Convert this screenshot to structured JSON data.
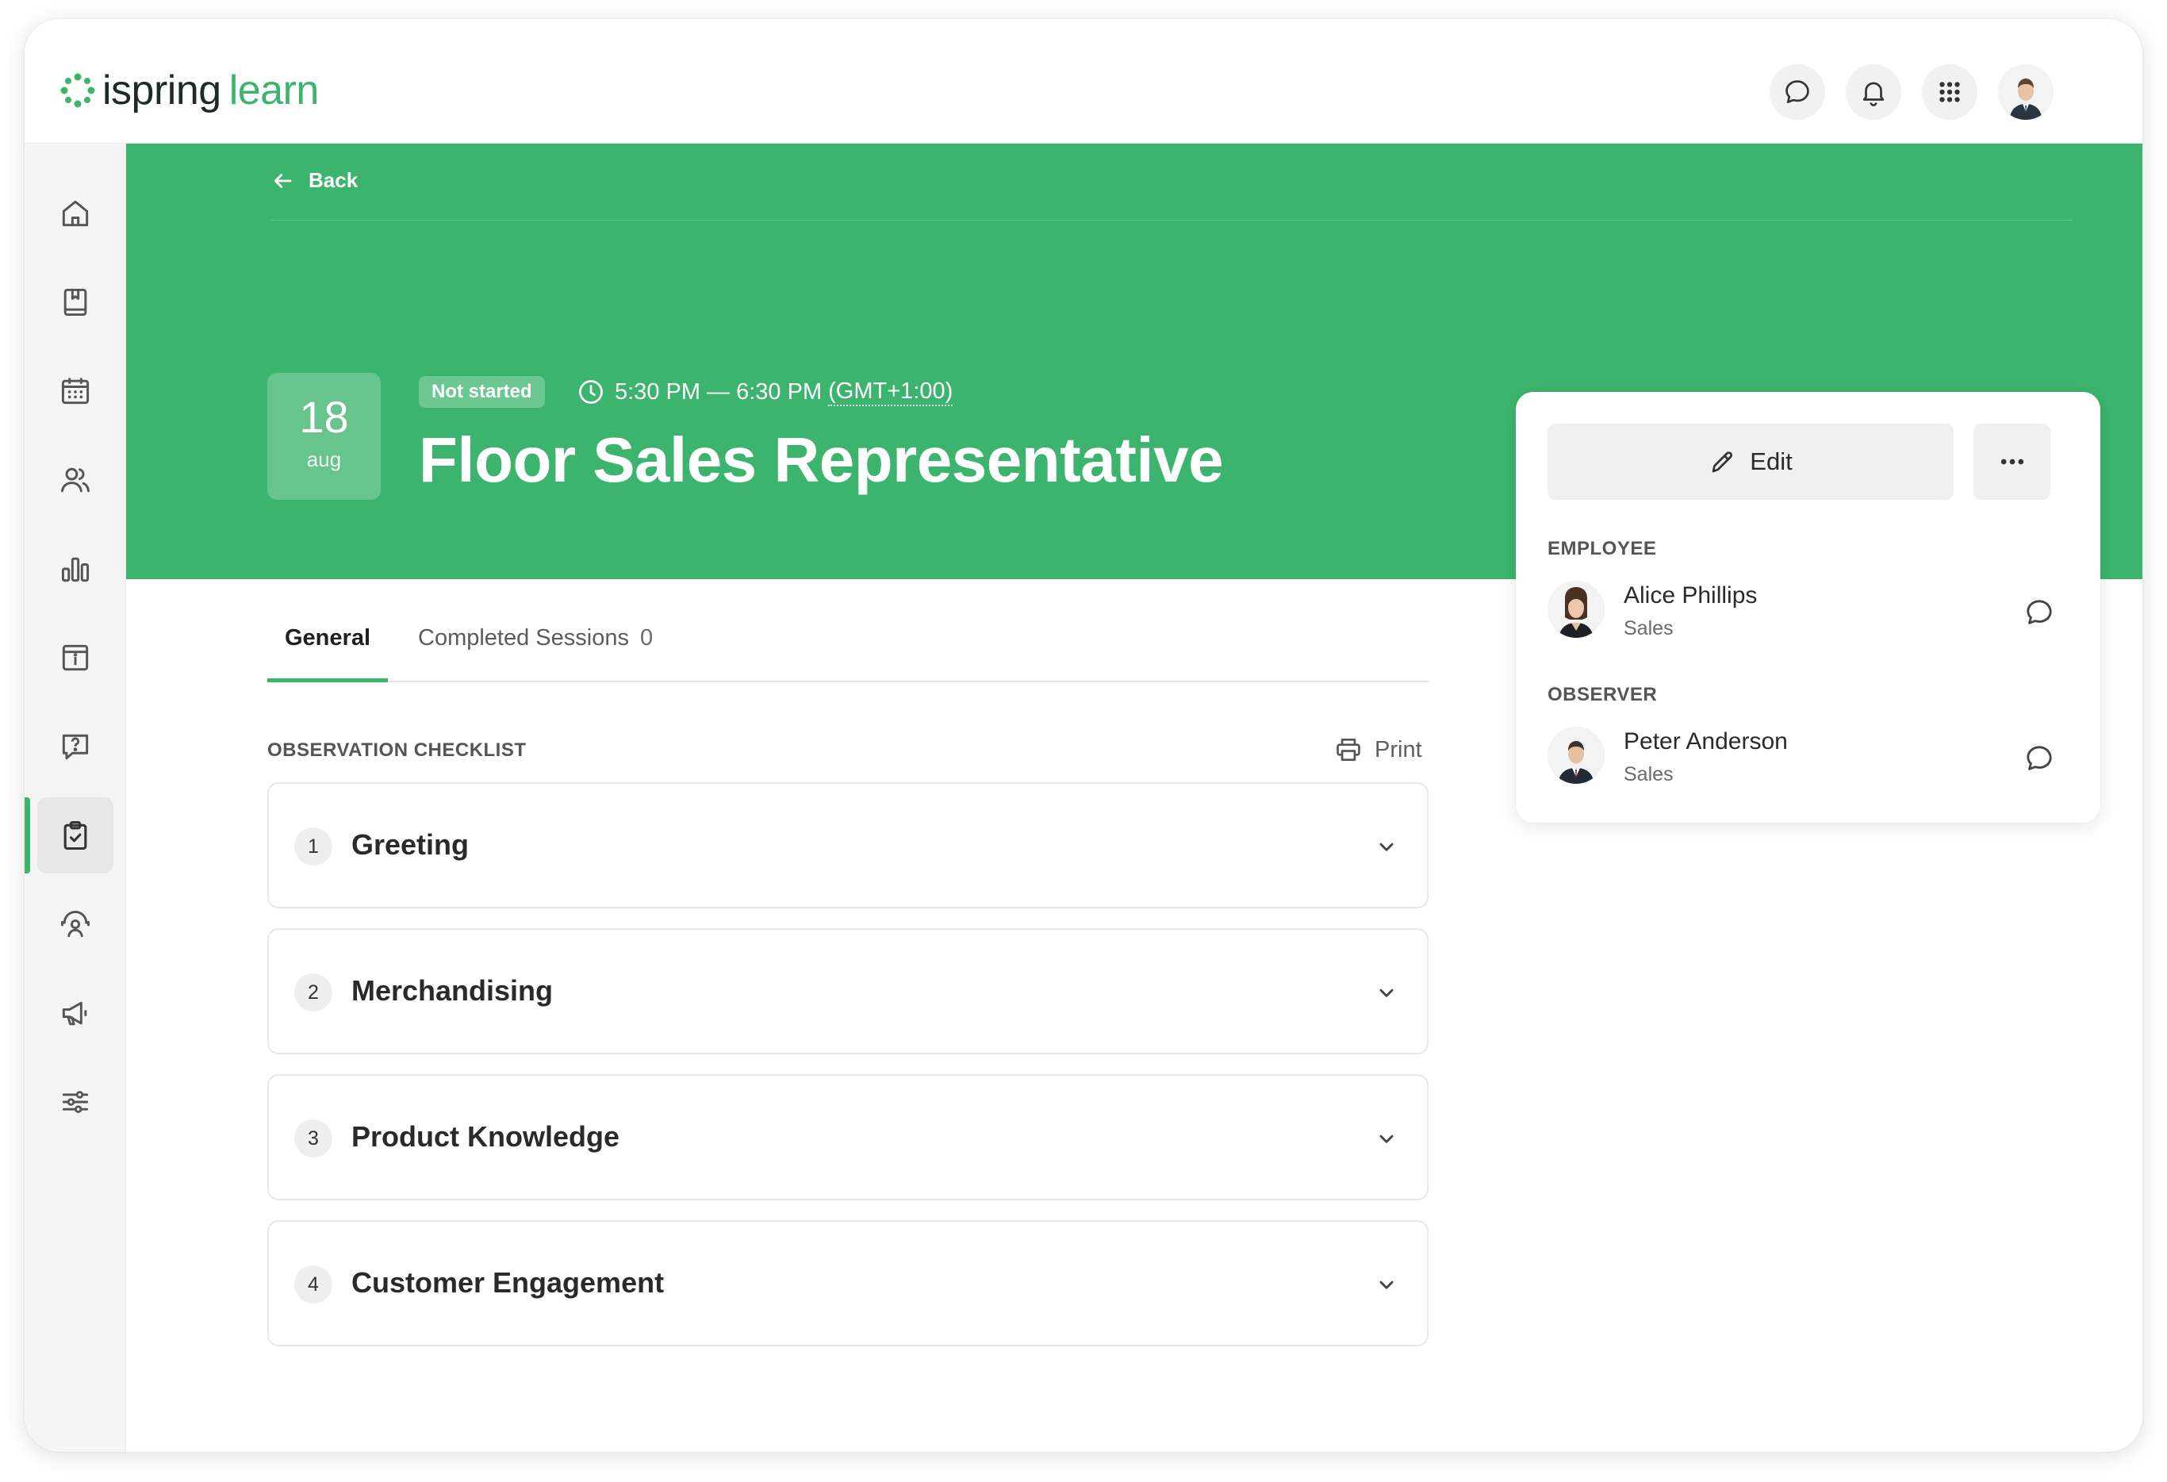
{
  "app": {
    "logo_part1": "ispring",
    "logo_part2": "learn",
    "accent_color": "#3db46d"
  },
  "topbar": {
    "icons": [
      "chat-icon",
      "bell-icon",
      "apps-grid-icon",
      "user-avatar"
    ]
  },
  "sidebar": {
    "items": [
      {
        "icon": "home-icon"
      },
      {
        "icon": "book-icon"
      },
      {
        "icon": "calendar-icon"
      },
      {
        "icon": "users-icon"
      },
      {
        "icon": "bar-chart-icon"
      },
      {
        "icon": "info-icon"
      },
      {
        "icon": "question-icon"
      },
      {
        "icon": "clipboard-check-icon",
        "active": true
      },
      {
        "icon": "mentor-icon"
      },
      {
        "icon": "megaphone-icon"
      },
      {
        "icon": "sliders-icon"
      }
    ]
  },
  "header": {
    "back_label": "Back",
    "date_day": "18",
    "date_month": "aug",
    "status": "Not started",
    "time_range": "5:30 PM — 6:30 PM",
    "timezone": "(GMT+1:00)",
    "title": "Floor Sales Representative"
  },
  "tabs": [
    {
      "label": "General",
      "active": true
    },
    {
      "label": "Completed Sessions",
      "count": "0"
    }
  ],
  "checklist": {
    "label": "OBSERVATION CHECKLIST",
    "print_label": "Print",
    "items": [
      {
        "number": "1",
        "title": "Greeting"
      },
      {
        "number": "2",
        "title": "Merchandising"
      },
      {
        "number": "3",
        "title": "Product Knowledge"
      },
      {
        "number": "4",
        "title": "Customer Engagement"
      }
    ]
  },
  "sidecard": {
    "edit_label": "Edit",
    "employee": {
      "role": "EMPLOYEE",
      "name": "Alice Phillips",
      "department": "Sales"
    },
    "observer": {
      "role": "OBSERVER",
      "name": "Peter Anderson",
      "department": "Sales"
    }
  }
}
